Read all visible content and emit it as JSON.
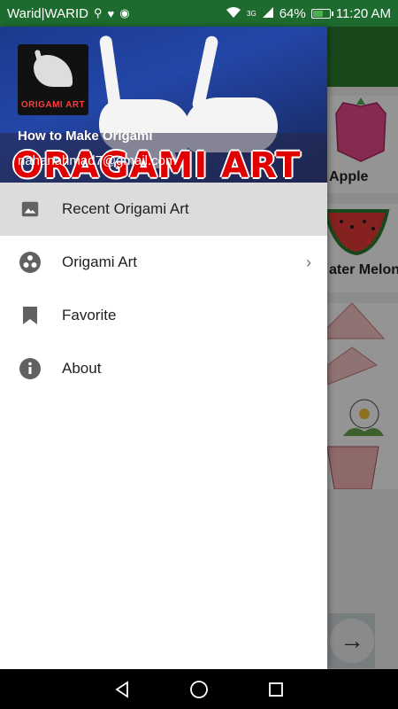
{
  "status_bar": {
    "carrier": "Warid|WARID",
    "signal_label": "3G",
    "battery": "64%",
    "battery_level": 0.64,
    "time": "11:20 AM"
  },
  "background_app": {
    "cards": [
      {
        "label": "Apple"
      },
      {
        "label": "ater Melon"
      }
    ]
  },
  "drawer": {
    "header": {
      "app_name": "How to Make Origami",
      "email": "nahanahmad7@gmail.com",
      "banner_text": "ORAGAMI ART",
      "logo_text": "ORIGAMI ART"
    },
    "menu": [
      {
        "label": "Recent Origami Art",
        "icon": "image-icon",
        "active": true
      },
      {
        "label": "Origami Art",
        "icon": "category-icon",
        "has_arrow": true
      },
      {
        "label": "Favorite",
        "icon": "bookmark-icon"
      },
      {
        "label": "About",
        "icon": "info-icon"
      }
    ],
    "arrow_glyph": "›"
  },
  "colors": {
    "status_bar": "#1e6b2f",
    "toolbar": "#2e7d32",
    "active_item": "#dcdcdc",
    "banner_red": "#e10000",
    "icon_gray": "#616161"
  }
}
